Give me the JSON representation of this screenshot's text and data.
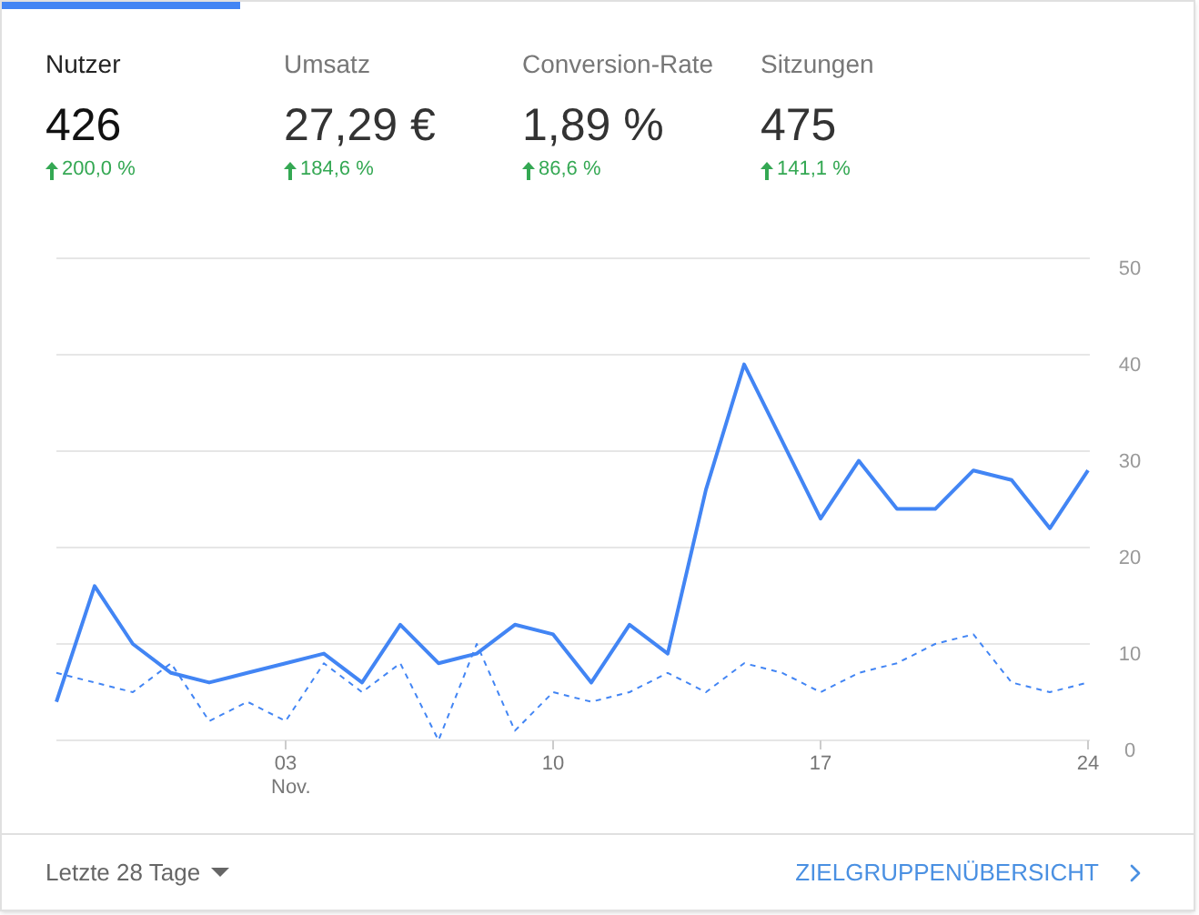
{
  "tabs": [
    {
      "label": "Nutzer",
      "value": "426",
      "change": "200,0 %",
      "selected": true
    },
    {
      "label": "Umsatz",
      "value": "27,29 €",
      "change": "184,6 %",
      "selected": false
    },
    {
      "label": "Conversion-Rate",
      "value": "1,89 %",
      "change": "86,6 %",
      "selected": false
    },
    {
      "label": "Sitzungen",
      "value": "475",
      "change": "141,1 %",
      "selected": false
    }
  ],
  "chart": {
    "month_label": "Nov.",
    "chart_data": {
      "type": "line",
      "categories": [
        null,
        null,
        null,
        null,
        null,
        null,
        "03",
        null,
        null,
        null,
        null,
        null,
        null,
        "10",
        null,
        null,
        null,
        null,
        null,
        null,
        "17",
        null,
        null,
        null,
        null,
        null,
        null,
        "24"
      ],
      "series": [
        {
          "color": "#4285f4",
          "line_style": "solid",
          "values": [
            4,
            16,
            10,
            7,
            6,
            7,
            8,
            9,
            6,
            12,
            8,
            9,
            12,
            11,
            6,
            12,
            9,
            26,
            39,
            31,
            23,
            29,
            24,
            24,
            28,
            27,
            22,
            28
          ]
        },
        {
          "color": "#4285f4",
          "line_style": "dashed",
          "values": [
            7,
            6,
            5,
            8,
            2,
            4,
            2,
            8,
            5,
            8,
            0,
            10,
            1,
            5,
            4,
            5,
            7,
            5,
            8,
            7,
            5,
            7,
            8,
            10,
            11,
            6,
            5,
            6
          ]
        }
      ],
      "grid": true,
      "ylim": [
        0,
        50
      ],
      "yticks": [
        0,
        10,
        20,
        30,
        40,
        50
      ]
    }
  },
  "footer": {
    "range": "Letzte 28 Tage",
    "link": "ZIELGRUPPENÜBERSICHT"
  }
}
